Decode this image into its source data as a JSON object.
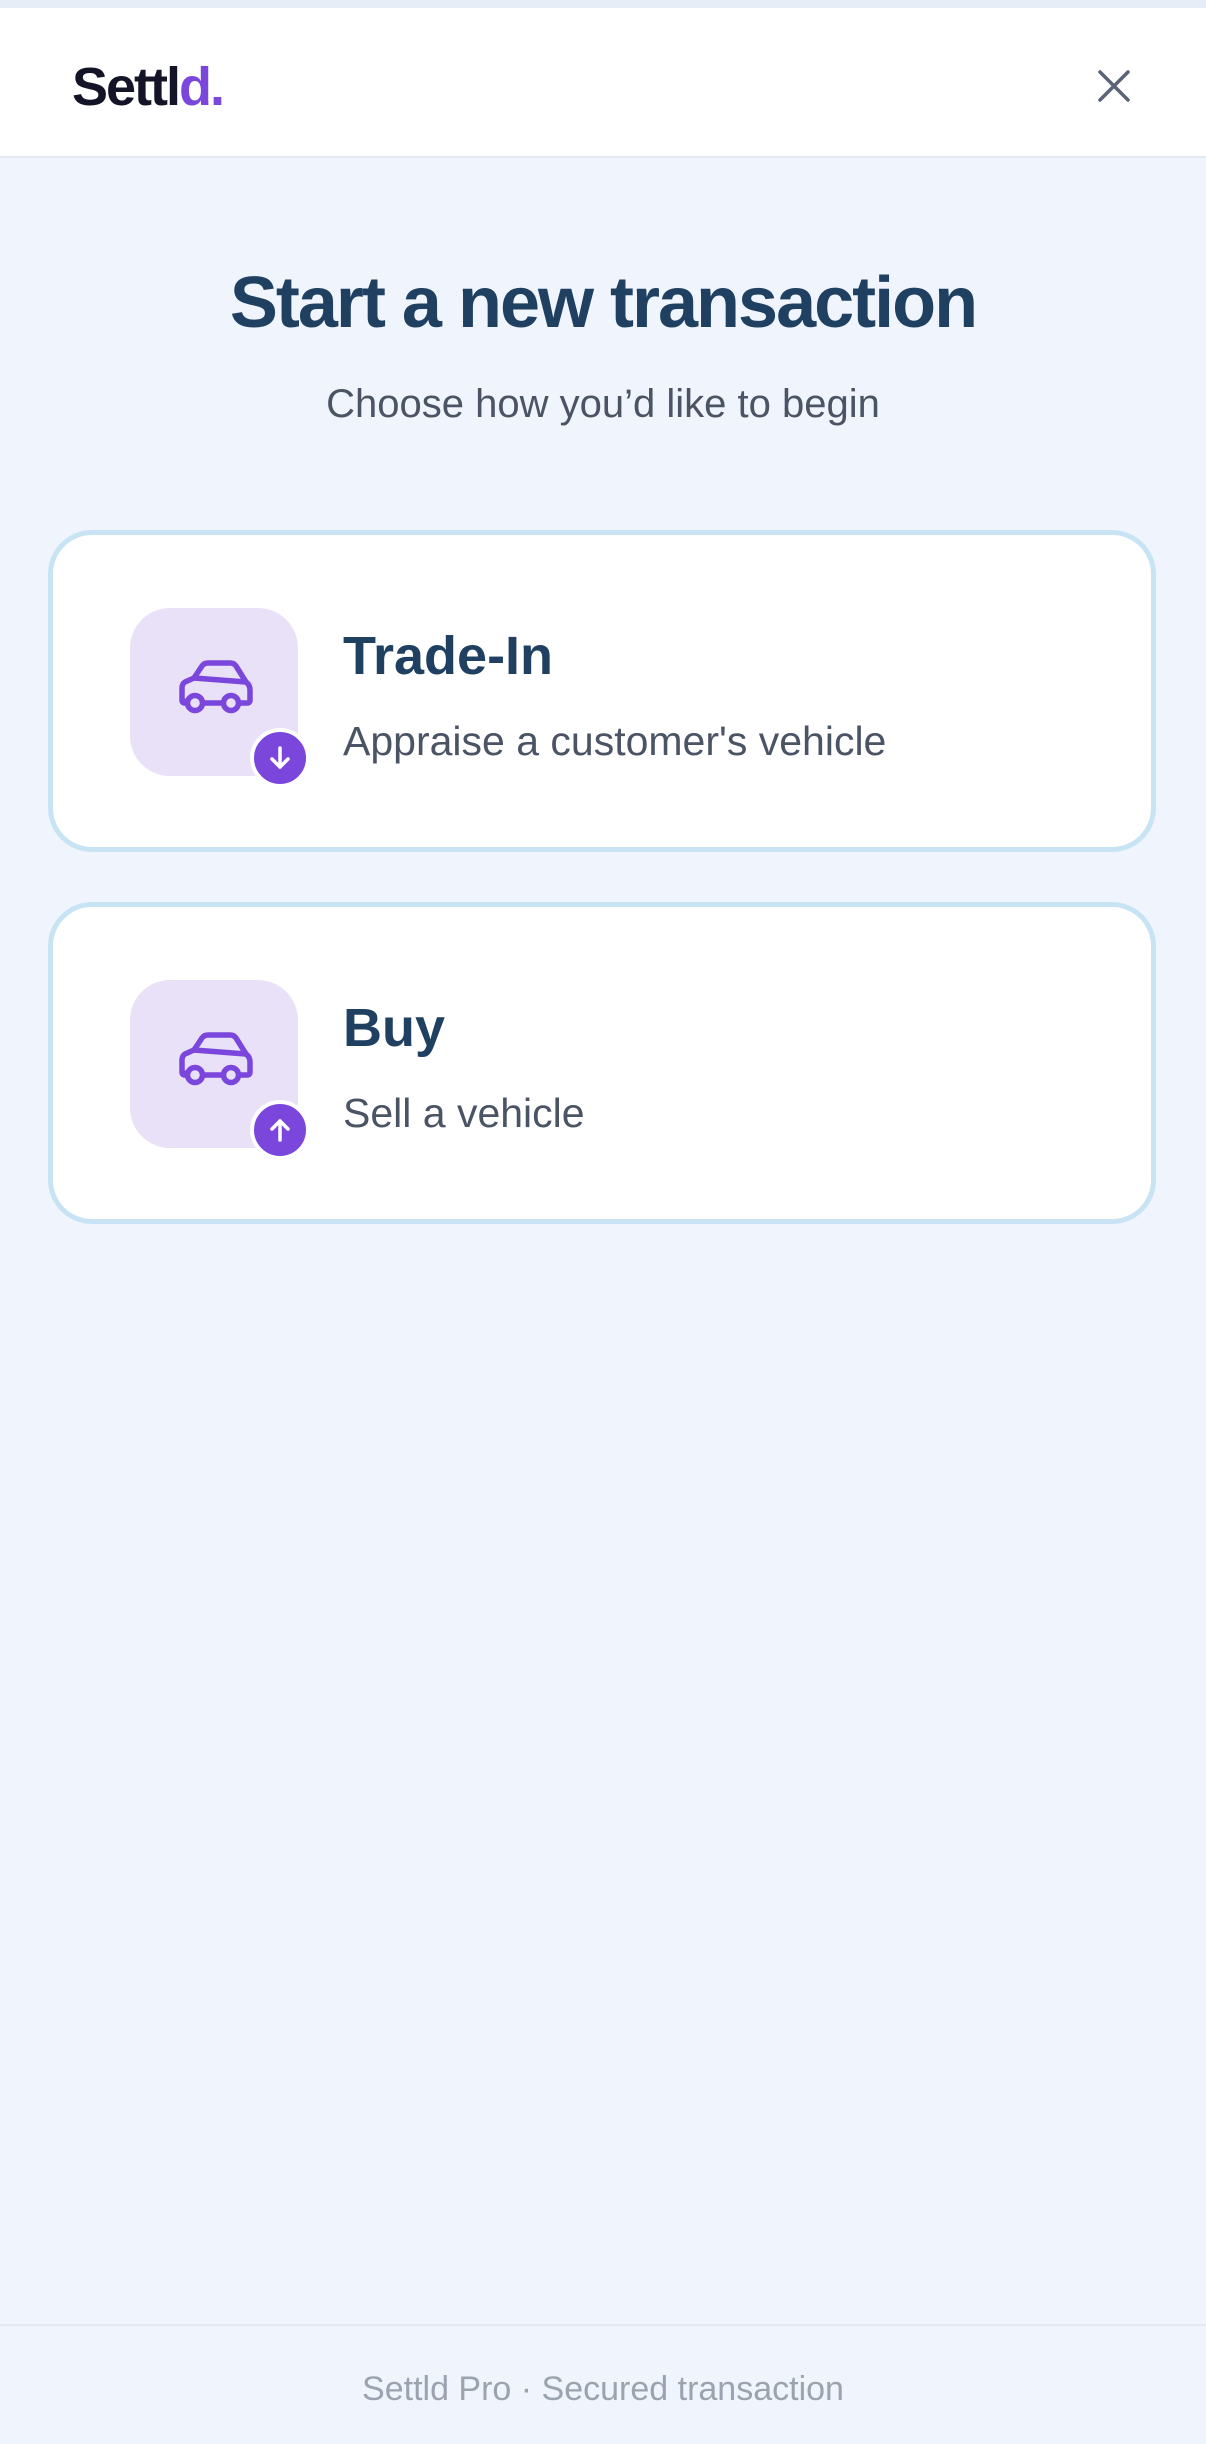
{
  "header": {
    "logo_main": "Settl",
    "logo_accent": "d.",
    "close_icon": "close-icon"
  },
  "page": {
    "title": "Start a new transaction",
    "subtitle": "Choose how you’d like to begin"
  },
  "options": [
    {
      "title": "Trade-In",
      "description": "Appraise a customer's vehicle",
      "icon": "car-icon",
      "badge_icon": "arrow-down-icon"
    },
    {
      "title": "Buy",
      "description": "Sell a vehicle",
      "icon": "car-icon",
      "badge_icon": "arrow-up-icon"
    }
  ],
  "footer": {
    "text": "Settld Pro · Secured transaction"
  },
  "colors": {
    "accent": "#7b46dc",
    "heading": "#1f4060",
    "background": "#eff4fd",
    "card_border": "#c8e4f4",
    "icon_tile": "#e9e1f8"
  }
}
